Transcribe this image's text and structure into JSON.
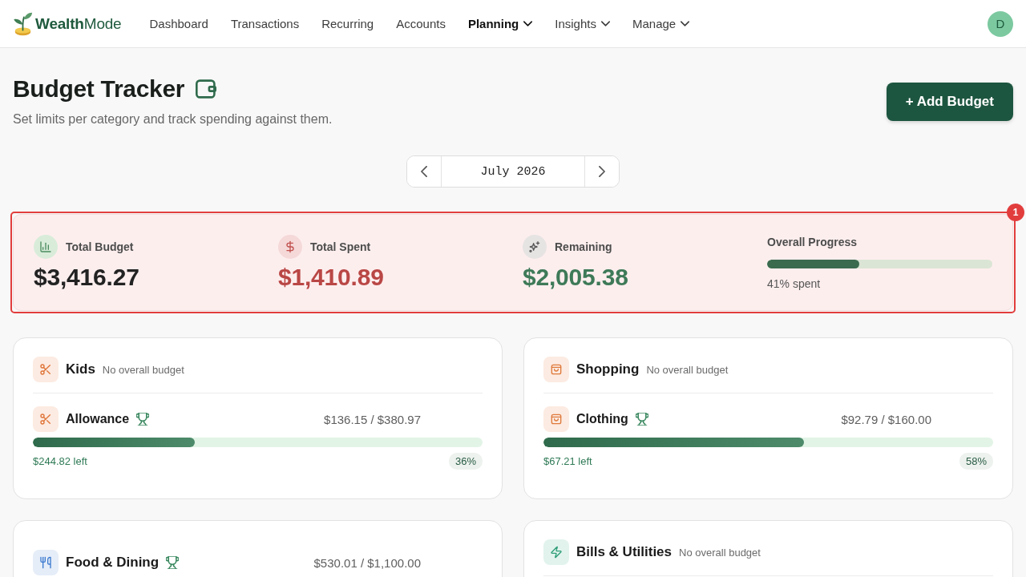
{
  "nav": {
    "logo": "**Wealth**Mode",
    "items": [
      {
        "label": "Dashboard",
        "selected": false,
        "dropdown": false
      },
      {
        "label": "Transactions",
        "selected": false,
        "dropdown": false
      },
      {
        "label": "Recurring",
        "selected": false,
        "dropdown": false
      },
      {
        "label": "Accounts",
        "selected": false,
        "dropdown": false
      },
      {
        "label": "Planning",
        "selected": true,
        "dropdown": true
      },
      {
        "label": "Insights",
        "selected": false,
        "dropdown": true
      },
      {
        "label": "Manage",
        "selected": false,
        "dropdown": true
      }
    ],
    "avatar": "D"
  },
  "page": {
    "title": "Budget Tracker",
    "subtitle": "Set limits per category and track spending against them.",
    "add_button": "+ Add Budget"
  },
  "month_picker": {
    "label": "July 2026"
  },
  "summary": {
    "annotation": "1",
    "stats": [
      {
        "kind": "total",
        "label": "Total Budget",
        "value": "$3,416.27"
      },
      {
        "kind": "spent",
        "label": "Total Spent",
        "value": "$1,410.89"
      },
      {
        "kind": "remaining",
        "label": "Remaining",
        "value": "$2,005.38"
      }
    ],
    "progress": {
      "label": "Overall Progress",
      "level": 0.41,
      "caption": "41% spent"
    }
  },
  "categories": [
    {
      "name": "Kids",
      "kind": "scissors",
      "note": "No overall budget",
      "items": [
        {
          "name": "Allowance",
          "kind": "scissors",
          "amount": "$136.15 / $380.97",
          "level": 0.36,
          "left": "$244.82 left",
          "percent": "36%"
        }
      ]
    },
    {
      "name": "Shopping",
      "kind": "bag",
      "note": "No overall budget",
      "items": [
        {
          "name": "Clothing",
          "kind": "bag",
          "amount": "$92.79 / $160.00",
          "level": 0.58,
          "left": "$67.21 left",
          "percent": "58%"
        }
      ]
    },
    {
      "name": "Food & Dining",
      "kind": "utensils",
      "amount": "$530.01 / $1,100.00"
    },
    {
      "name": "Bills & Utilities",
      "kind": "bolt",
      "note": "No overall budget"
    }
  ]
}
